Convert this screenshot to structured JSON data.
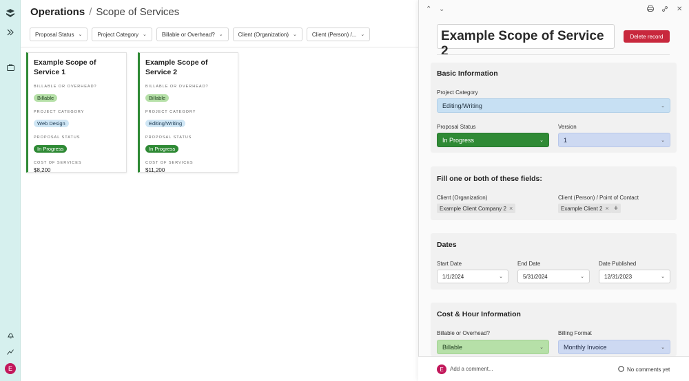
{
  "header": {
    "section": "Operations",
    "separator": "/",
    "page": "Scope of Services"
  },
  "filters": [
    "Proposal Status",
    "Project Category",
    "Billable or Overhead?",
    "Client (Organization)",
    "Client (Person) /..."
  ],
  "cards": [
    {
      "title": "Example Scope of Service 1",
      "billable_label": "BILLABLE OR OVERHEAD?",
      "billable": "Billable",
      "category_label": "PROJECT CATEGORY",
      "category": "Web Design",
      "status_label": "PROPOSAL STATUS",
      "status": "In Progress",
      "cost_label": "COST OF SERVICES",
      "cost": "$8,200"
    },
    {
      "title": "Example Scope of Service 2",
      "billable_label": "BILLABLE OR OVERHEAD?",
      "billable": "Billable",
      "category_label": "PROJECT CATEGORY",
      "category": "Editing/Writing",
      "status_label": "PROPOSAL STATUS",
      "status": "In Progress",
      "cost_label": "COST OF SERVICES",
      "cost": "$11,200"
    }
  ],
  "user": {
    "initial": "E"
  },
  "record": {
    "title": "Example Scope of Service 2",
    "delete_label": "Delete record",
    "basic": {
      "heading": "Basic Information",
      "category_label": "Project Category",
      "category": "Editing/Writing",
      "status_label": "Proposal Status",
      "status": "In Progress",
      "version_label": "Version",
      "version": "1"
    },
    "clients": {
      "heading": "Fill one or both of these fields:",
      "org_label": "Client (Organization)",
      "org": "Example Client Company 2",
      "person_label": "Client (Person) / Point of Contact",
      "person": "Example Client 2",
      "plus": "+"
    },
    "dates": {
      "heading": "Dates",
      "start_label": "Start Date",
      "start": "1/1/2024",
      "end_label": "End Date",
      "end": "5/31/2024",
      "published_label": "Date Published",
      "published": "12/31/2023"
    },
    "cost": {
      "heading": "Cost & Hour Information",
      "billable_label": "Billable or Overhead?",
      "billable": "Billable",
      "format_label": "Billing Format",
      "format": "Monthly Invoice"
    }
  },
  "comments": {
    "placeholder": "Add a comment...",
    "empty": "No comments yet"
  },
  "colors": {
    "rail": "#d6f0ee",
    "accent_green": "#2f8a35",
    "danger": "#c8283d",
    "light_blue": "#c7e0f3"
  }
}
